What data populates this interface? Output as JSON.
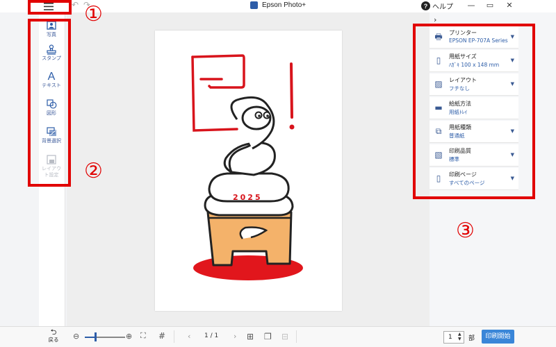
{
  "titlebar": {
    "app_title": "Epson Photo+",
    "help_label": "ヘルプ",
    "help_icon": "question-icon"
  },
  "left_tools": [
    {
      "label": "写真",
      "icon": "photo-icon",
      "enabled": true
    },
    {
      "label": "スタンプ",
      "icon": "stamp-icon",
      "enabled": true
    },
    {
      "label": "テキスト",
      "icon": "text-icon",
      "enabled": true
    },
    {
      "label": "図形",
      "icon": "shape-icon",
      "enabled": true
    },
    {
      "label": "背景選択",
      "icon": "background-icon",
      "enabled": true
    },
    {
      "label": "レイアウト設定",
      "icon": "layout-icon",
      "enabled": false
    }
  ],
  "settings": [
    {
      "name": "プリンター",
      "value": "EPSON EP-707A Series",
      "icon": "printer-icon"
    },
    {
      "name": "用紙サイズ",
      "value": "ﾊｶﾞｷ 100 x 148 mm",
      "icon": "paper-size-icon"
    },
    {
      "name": "レイアウト",
      "value": "フチなし",
      "icon": "layout-icon"
    },
    {
      "name": "給紙方法",
      "value": "用紙ﾄﾚｲ",
      "icon": "feed-icon"
    },
    {
      "name": "用紙種類",
      "value": "普通紙",
      "icon": "paper-type-icon"
    },
    {
      "name": "印刷品質",
      "value": "標準",
      "icon": "quality-icon"
    },
    {
      "name": "印刷ページ",
      "value": "すべてのページ",
      "icon": "page-icon"
    }
  ],
  "artwork": {
    "year_text": "2025"
  },
  "bottom": {
    "back_label": "戻る",
    "page_indicator": "1 / 1",
    "copies_value": "1",
    "copies_unit": "部",
    "print_label": "印刷開始",
    "zoom_level": 0.25
  },
  "annotations": {
    "num1": "①",
    "num2": "②",
    "num3": "③"
  },
  "colors": {
    "accent": "#2d5da8",
    "print_button": "#3a86d8",
    "annotation": "#e10000"
  }
}
